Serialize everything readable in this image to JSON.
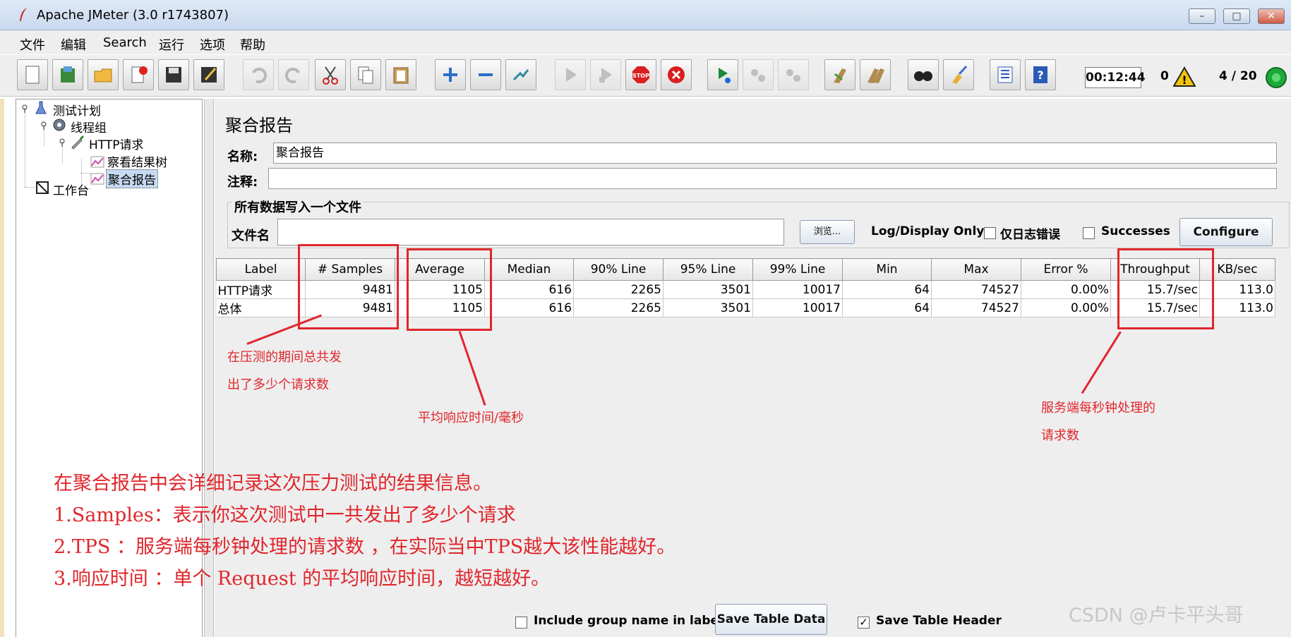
{
  "window": {
    "title": "Apache JMeter (3.0 r1743807)"
  },
  "menu": [
    "文件",
    "编辑",
    "Search",
    "运行",
    "选项",
    "帮助"
  ],
  "toolbar": {
    "buttons": [
      "new-icon",
      "templates-icon",
      "open-icon",
      "close-icon",
      "save-icon",
      "save-as-icon",
      "undo-icon",
      "redo-icon",
      "cut-icon",
      "copy-icon",
      "paste-icon",
      "expand-icon",
      "collapse-icon",
      "toggle-icon",
      "start-icon",
      "start-no-timers-icon",
      "stop-icon",
      "shutdown-icon",
      "remote-start-icon",
      "remote-stop-icon",
      "remote-exit-icon",
      "clear-icon",
      "clear-all-icon",
      "search-icon",
      "reset-search-icon",
      "function-helper-icon",
      "help-icon"
    ],
    "timer": "00:12:44",
    "error_count": "0",
    "threads": "4 / 20"
  },
  "tree": {
    "items": [
      "测试计划",
      "线程组",
      "HTTP请求",
      "察看结果树",
      "聚合报告",
      "工作台"
    ]
  },
  "panel": {
    "title": "聚合报告",
    "name_label": "名称:",
    "name_value": "聚合报告",
    "comment_label": "注释:",
    "comment_value": "",
    "file_group_title": "所有数据写入一个文件",
    "file_label": "文件名",
    "file_value": "",
    "browse": "浏览...",
    "log_display": "Log/Display Only:",
    "errors_only": "仅日志错误",
    "successes": "Successes",
    "configure": "Configure"
  },
  "table": {
    "columns": [
      "Label",
      "# Samples",
      "Average",
      "Median",
      "90% Line",
      "95% Line",
      "99% Line",
      "Min",
      "Max",
      "Error %",
      "Throughput",
      "KB/sec"
    ],
    "rows": [
      [
        "HTTP请求",
        "9481",
        "1105",
        "616",
        "2265",
        "3501",
        "10017",
        "64",
        "74527",
        "0.00%",
        "15.7/sec",
        "113.0"
      ],
      [
        "总体",
        "9481",
        "1105",
        "616",
        "2265",
        "3501",
        "10017",
        "64",
        "74527",
        "0.00%",
        "15.7/sec",
        "113.0"
      ]
    ]
  },
  "bottom": {
    "include_group": "Include group name in label?",
    "include_group_checked": false,
    "save_table_data": "Save Table Data",
    "save_table_header": "Save Table Header",
    "save_table_header_checked": true
  },
  "annotations": {
    "samples_note_line1": "在压测的期间总共发",
    "samples_note_line2": "出了多少个请求数",
    "average_note": "平均响应时间/毫秒",
    "throughput_note_line1": "服务端每秒钟处理的",
    "throughput_note_line2": "请求数",
    "summary": [
      "在聚合报告中会详细记录这次压力测试的结果信息。",
      "1.Samples：表示你这次测试中一共发出了多少个请求",
      "2.TPS ：服务端每秒钟处理的请求数 ，在实际当中TPS越大该性能越好。",
      "3.响应时间 ：单个 Request 的平均响应时间，越短越好。"
    ],
    "color": "#e0262c"
  },
  "watermark": "CSDN @卢卡平头哥"
}
